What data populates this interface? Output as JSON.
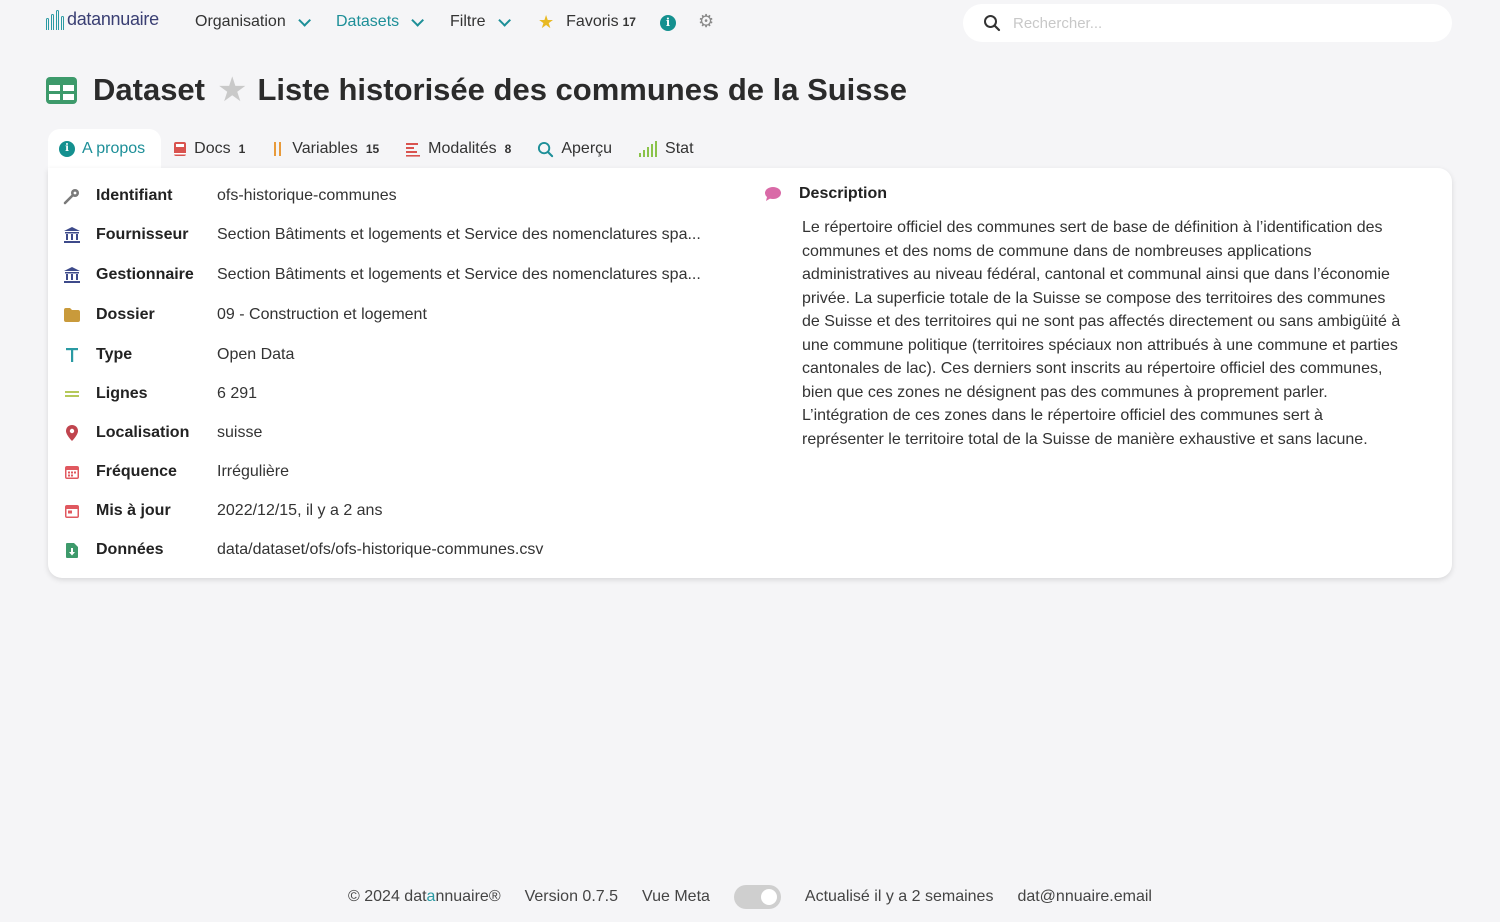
{
  "nav": {
    "logo_part1": "dat",
    "logo_part2": "annuaire",
    "organisation": "Organisation",
    "datasets": "Datasets",
    "filtre": "Filtre",
    "favoris": "Favoris",
    "favoris_count": "17",
    "search_placeholder": "Rechercher...",
    "icons": {
      "favoris": "star-icon",
      "info": "info-icon",
      "settings": "gear-icon",
      "search": "search-icon"
    }
  },
  "header": {
    "kind": "Dataset",
    "title": "Liste historisée des communes de la Suisse"
  },
  "tabs": [
    {
      "label": "A propos",
      "count": ""
    },
    {
      "label": "Docs",
      "count": "1"
    },
    {
      "label": "Variables",
      "count": "15"
    },
    {
      "label": "Modalités",
      "count": "8"
    },
    {
      "label": "Aperçu",
      "count": ""
    },
    {
      "label": "Stat",
      "count": ""
    }
  ],
  "fields": [
    {
      "label": "Identifiant",
      "value": "ofs-historique-communes",
      "icon": "key-icon"
    },
    {
      "label": "Fournisseur",
      "value": "Section Bâtiments et logements et Service des nomenclatures spa...",
      "icon": "institution-icon"
    },
    {
      "label": "Gestionnaire",
      "value": "Section Bâtiments et logements et Service des nomenclatures spa...",
      "icon": "institution-icon"
    },
    {
      "label": "Dossier",
      "value": "09 - Construction et logement",
      "icon": "folder-icon"
    },
    {
      "label": "Type",
      "value": "Open Data",
      "icon": "type-icon"
    },
    {
      "label": "Lignes",
      "value": "6 291",
      "icon": "lines-icon"
    },
    {
      "label": "Localisation",
      "value": "suisse",
      "icon": "location-pin-icon"
    },
    {
      "label": "Fréquence",
      "value": "Irrégulière",
      "icon": "calendar-icon"
    },
    {
      "label": "Mis à jour",
      "value": "2022/12/15, il y a 2 ans",
      "icon": "calendar-icon"
    },
    {
      "label": "Données",
      "value": "data/dataset/ofs/ofs-historique-communes.csv",
      "icon": "file-download-icon"
    }
  ],
  "description": {
    "label": "Description",
    "text": "Le répertoire officiel des communes sert de base de définition à l’identification des communes et des noms de commune dans de nombreuses applications administratives au niveau fédéral, cantonal et communal ainsi que dans l’économie privée. La superficie totale de la Suisse se compose des territoires des communes de Suisse et des territoires qui ne sont pas affectés directement ou sans ambigüité à une commune politique (territoires spéciaux non attribués à une commune et parties cantonales de lac). Ces derniers sont inscrits au répertoire officiel des communes, bien que ces zones ne désignent pas des communes à proprement parler. L’intégration de ces zones dans le répertoire officiel des communes sert à représenter le territoire total de la Suisse de manière exhaustive et sans lacune."
  },
  "footer": {
    "copyright_prefix": "© 2024 dat",
    "copyright_accent": "a",
    "copyright_suffix": "nnuaire®",
    "version": "Version 0.7.5",
    "vue_meta": "Vue Meta",
    "updated": "Actualisé il y a 2 semaines",
    "email": "dat@nnuaire.email"
  },
  "colors": {
    "accent": "#1d8f98",
    "star": "#e8b923",
    "table_icon": "#3d9a6b",
    "background": "#f5f5f7"
  }
}
